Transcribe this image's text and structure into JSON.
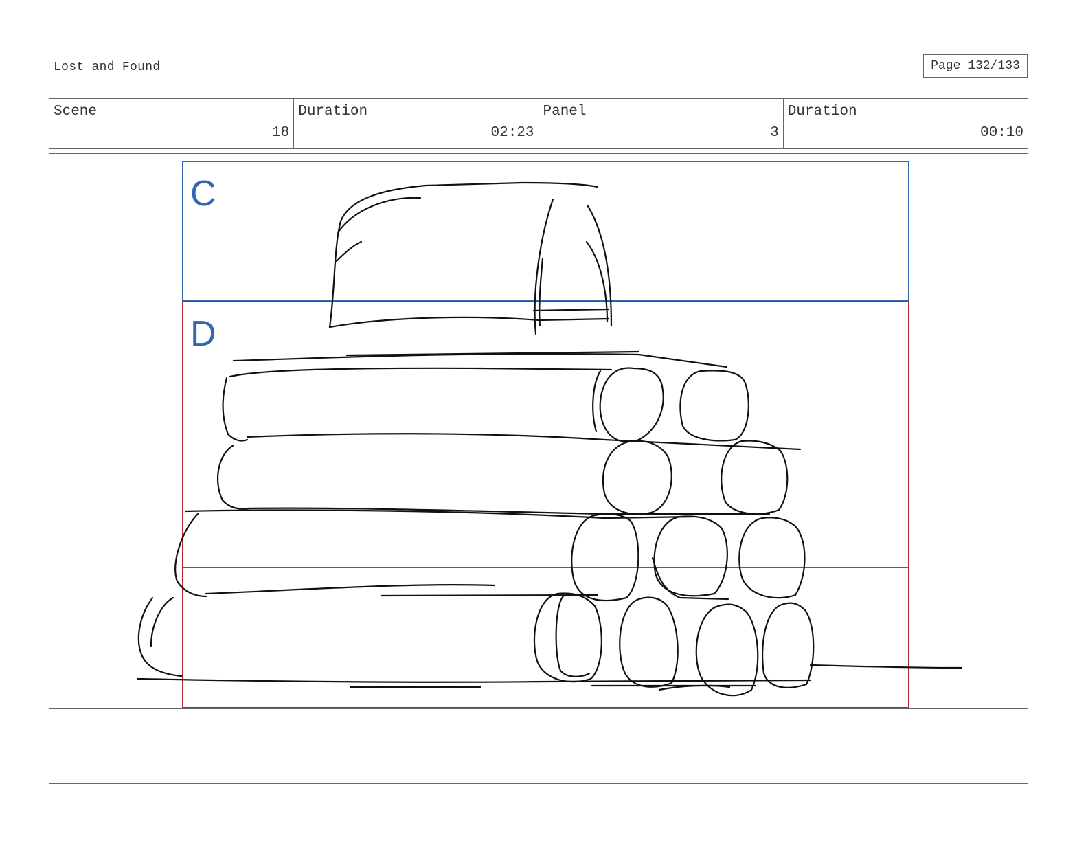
{
  "header": {
    "title": "Lost and Found",
    "page": "Page 132/133"
  },
  "info": {
    "scene_label": "Scene",
    "scene_value": "18",
    "scene_duration_label": "Duration",
    "scene_duration_value": "02:23",
    "panel_label": "Panel",
    "panel_value": "3",
    "panel_duration_label": "Duration",
    "panel_duration_value": "00:10"
  },
  "frame": {
    "zones": [
      {
        "label": "C",
        "color": "#2f67b2"
      },
      {
        "label": "D",
        "color": "#b22a2a"
      }
    ],
    "sketch_color": "#111111"
  },
  "notes": {
    "text": ""
  }
}
